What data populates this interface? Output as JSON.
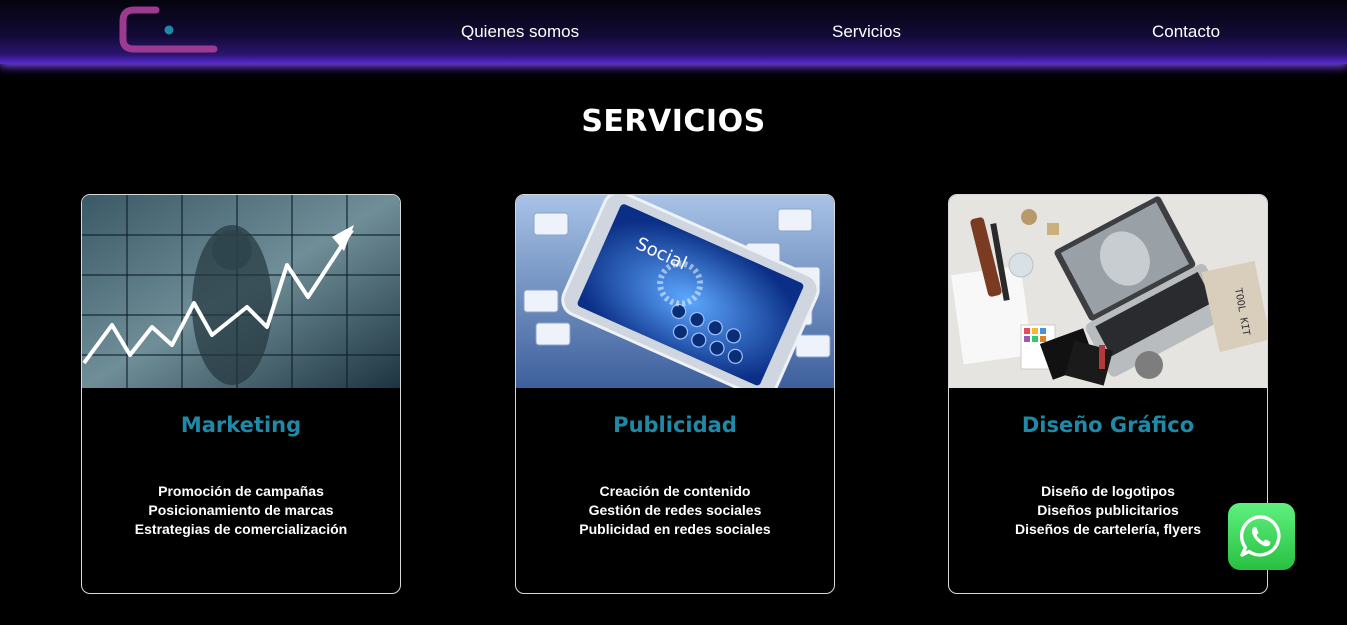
{
  "header": {
    "logo_icon": "brand-logo-icon",
    "colors": {
      "logo_stroke": "#9b3a8f",
      "logo_dot": "#1f8aa8",
      "glow": "#7b3ff2"
    },
    "nav": [
      {
        "label": "Quienes somos"
      },
      {
        "label": "Servicios"
      },
      {
        "label": "Contacto"
      }
    ]
  },
  "main": {
    "title": "SERVICIOS",
    "accent_color": "#1f8aa8",
    "cards": [
      {
        "title": "Marketing",
        "image_icon": "marketing-chart-image",
        "items": [
          "Promoción de campañas",
          "Posicionamiento de marcas",
          "Estrategias de comercialización"
        ]
      },
      {
        "title": "Publicidad",
        "image_icon": "social-phone-image",
        "image_text": "Social",
        "items": [
          "Creación de contenido",
          "Gestión de redes sociales",
          "Publicidad en redes sociales"
        ]
      },
      {
        "title": "Diseño Gráfico",
        "image_icon": "design-desk-image",
        "image_text": "TOOL KIT",
        "items": [
          "Diseño de logotipos",
          "Diseños publicitarios",
          "Diseños de cartelería, flyers"
        ]
      }
    ]
  },
  "whatsapp": {
    "icon": "whatsapp-icon",
    "color": "#25d366"
  }
}
